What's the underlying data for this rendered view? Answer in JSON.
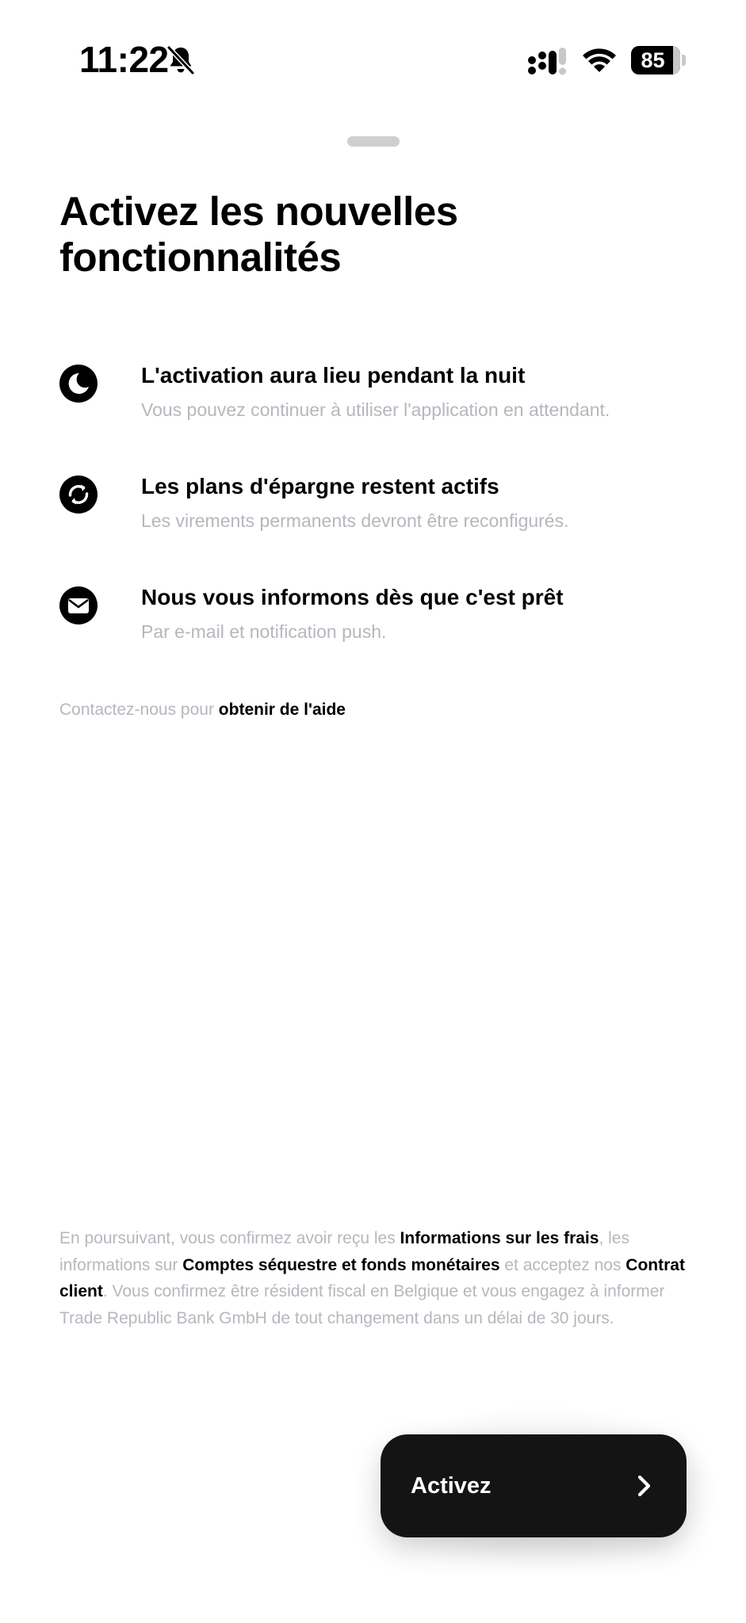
{
  "status_bar": {
    "time": "11:22",
    "battery_level": "85",
    "battery_fraction": 0.85,
    "icons": [
      "bell-slash-icon",
      "signal-icon",
      "wifi-icon",
      "battery-icon"
    ]
  },
  "title": "Activez les nouvelles fonctionnalités",
  "features": [
    {
      "icon": "moon-icon",
      "title": "L'activation aura lieu pendant la nuit",
      "subtitle": "Vous pouvez continuer à utiliser l'application en attendant."
    },
    {
      "icon": "sync-icon",
      "title": "Les plans d'épargne restent actifs",
      "subtitle": "Les virements permanents devront être reconfigurés."
    },
    {
      "icon": "mail-icon",
      "title": "Nous vous informons dès que c'est prêt",
      "subtitle": "Par e-mail et notification push."
    }
  ],
  "help": {
    "prefix": "Contactez-nous pour ",
    "link": "obtenir de l'aide"
  },
  "legal": {
    "part1": "En poursuivant, vous confirmez avoir reçu les ",
    "link1": "Informations sur les frais",
    "part2": ", les informations sur ",
    "link2": "Comptes séquestre et fonds monétaires",
    "part3": " et acceptez nos ",
    "link3": "Contrat client",
    "part4": ". Vous confirmez être résident fiscal en Belgique et vous engagez à informer Trade Republic Bank GmbH de tout changement dans un délai de 30 jours."
  },
  "cta": {
    "label": "Activez",
    "icon": "chevron-right-icon"
  },
  "colors": {
    "text": "#000000",
    "muted": "#b4b8bd",
    "button_bg": "#141414",
    "button_text": "#ffffff",
    "grabber": "#cfcfcf"
  }
}
